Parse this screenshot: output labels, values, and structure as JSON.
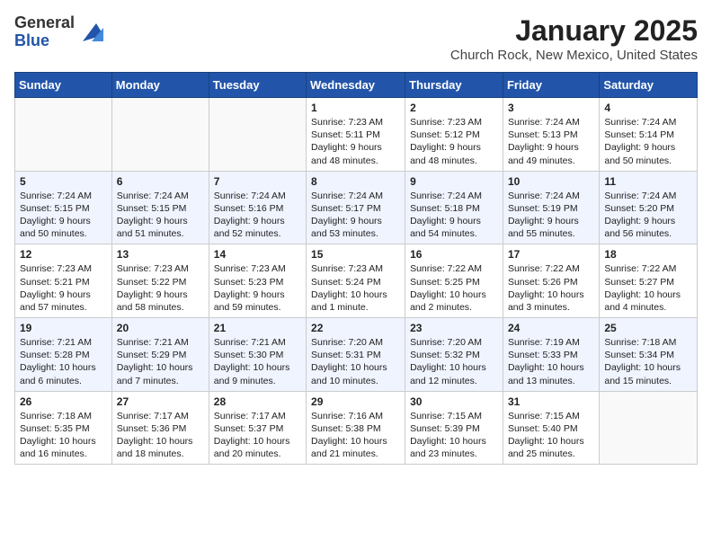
{
  "header": {
    "logo_line1": "General",
    "logo_line2": "Blue",
    "title": "January 2025",
    "subtitle": "Church Rock, New Mexico, United States"
  },
  "weekdays": [
    "Sunday",
    "Monday",
    "Tuesday",
    "Wednesday",
    "Thursday",
    "Friday",
    "Saturday"
  ],
  "weeks": [
    [
      {
        "day": "",
        "info": ""
      },
      {
        "day": "",
        "info": ""
      },
      {
        "day": "",
        "info": ""
      },
      {
        "day": "1",
        "info": "Sunrise: 7:23 AM\nSunset: 5:11 PM\nDaylight: 9 hours and 48 minutes."
      },
      {
        "day": "2",
        "info": "Sunrise: 7:23 AM\nSunset: 5:12 PM\nDaylight: 9 hours and 48 minutes."
      },
      {
        "day": "3",
        "info": "Sunrise: 7:24 AM\nSunset: 5:13 PM\nDaylight: 9 hours and 49 minutes."
      },
      {
        "day": "4",
        "info": "Sunrise: 7:24 AM\nSunset: 5:14 PM\nDaylight: 9 hours and 50 minutes."
      }
    ],
    [
      {
        "day": "5",
        "info": "Sunrise: 7:24 AM\nSunset: 5:15 PM\nDaylight: 9 hours and 50 minutes."
      },
      {
        "day": "6",
        "info": "Sunrise: 7:24 AM\nSunset: 5:15 PM\nDaylight: 9 hours and 51 minutes."
      },
      {
        "day": "7",
        "info": "Sunrise: 7:24 AM\nSunset: 5:16 PM\nDaylight: 9 hours and 52 minutes."
      },
      {
        "day": "8",
        "info": "Sunrise: 7:24 AM\nSunset: 5:17 PM\nDaylight: 9 hours and 53 minutes."
      },
      {
        "day": "9",
        "info": "Sunrise: 7:24 AM\nSunset: 5:18 PM\nDaylight: 9 hours and 54 minutes."
      },
      {
        "day": "10",
        "info": "Sunrise: 7:24 AM\nSunset: 5:19 PM\nDaylight: 9 hours and 55 minutes."
      },
      {
        "day": "11",
        "info": "Sunrise: 7:24 AM\nSunset: 5:20 PM\nDaylight: 9 hours and 56 minutes."
      }
    ],
    [
      {
        "day": "12",
        "info": "Sunrise: 7:23 AM\nSunset: 5:21 PM\nDaylight: 9 hours and 57 minutes."
      },
      {
        "day": "13",
        "info": "Sunrise: 7:23 AM\nSunset: 5:22 PM\nDaylight: 9 hours and 58 minutes."
      },
      {
        "day": "14",
        "info": "Sunrise: 7:23 AM\nSunset: 5:23 PM\nDaylight: 9 hours and 59 minutes."
      },
      {
        "day": "15",
        "info": "Sunrise: 7:23 AM\nSunset: 5:24 PM\nDaylight: 10 hours and 1 minute."
      },
      {
        "day": "16",
        "info": "Sunrise: 7:22 AM\nSunset: 5:25 PM\nDaylight: 10 hours and 2 minutes."
      },
      {
        "day": "17",
        "info": "Sunrise: 7:22 AM\nSunset: 5:26 PM\nDaylight: 10 hours and 3 minutes."
      },
      {
        "day": "18",
        "info": "Sunrise: 7:22 AM\nSunset: 5:27 PM\nDaylight: 10 hours and 4 minutes."
      }
    ],
    [
      {
        "day": "19",
        "info": "Sunrise: 7:21 AM\nSunset: 5:28 PM\nDaylight: 10 hours and 6 minutes."
      },
      {
        "day": "20",
        "info": "Sunrise: 7:21 AM\nSunset: 5:29 PM\nDaylight: 10 hours and 7 minutes."
      },
      {
        "day": "21",
        "info": "Sunrise: 7:21 AM\nSunset: 5:30 PM\nDaylight: 10 hours and 9 minutes."
      },
      {
        "day": "22",
        "info": "Sunrise: 7:20 AM\nSunset: 5:31 PM\nDaylight: 10 hours and 10 minutes."
      },
      {
        "day": "23",
        "info": "Sunrise: 7:20 AM\nSunset: 5:32 PM\nDaylight: 10 hours and 12 minutes."
      },
      {
        "day": "24",
        "info": "Sunrise: 7:19 AM\nSunset: 5:33 PM\nDaylight: 10 hours and 13 minutes."
      },
      {
        "day": "25",
        "info": "Sunrise: 7:18 AM\nSunset: 5:34 PM\nDaylight: 10 hours and 15 minutes."
      }
    ],
    [
      {
        "day": "26",
        "info": "Sunrise: 7:18 AM\nSunset: 5:35 PM\nDaylight: 10 hours and 16 minutes."
      },
      {
        "day": "27",
        "info": "Sunrise: 7:17 AM\nSunset: 5:36 PM\nDaylight: 10 hours and 18 minutes."
      },
      {
        "day": "28",
        "info": "Sunrise: 7:17 AM\nSunset: 5:37 PM\nDaylight: 10 hours and 20 minutes."
      },
      {
        "day": "29",
        "info": "Sunrise: 7:16 AM\nSunset: 5:38 PM\nDaylight: 10 hours and 21 minutes."
      },
      {
        "day": "30",
        "info": "Sunrise: 7:15 AM\nSunset: 5:39 PM\nDaylight: 10 hours and 23 minutes."
      },
      {
        "day": "31",
        "info": "Sunrise: 7:15 AM\nSunset: 5:40 PM\nDaylight: 10 hours and 25 minutes."
      },
      {
        "day": "",
        "info": ""
      }
    ]
  ]
}
